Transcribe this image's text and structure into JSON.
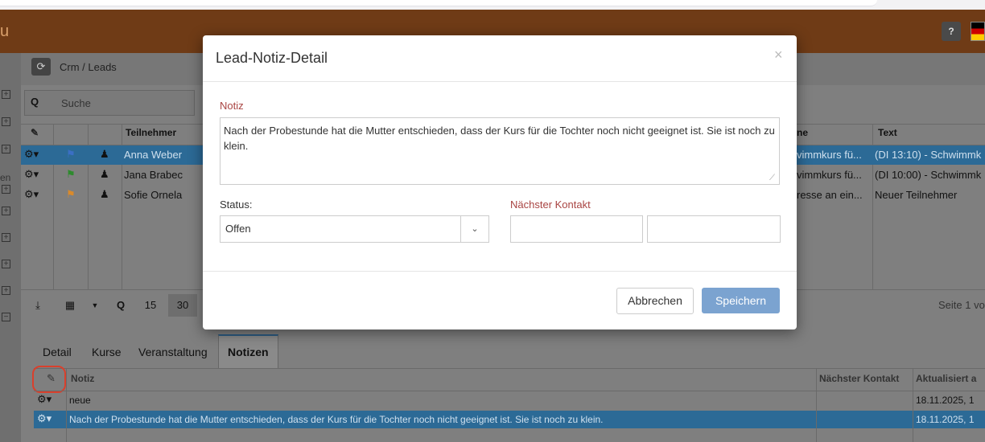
{
  "app": {
    "brand": "u"
  },
  "header": {
    "help_label": "?",
    "flag_label": "de"
  },
  "left_nav": {
    "labels": [
      "en"
    ]
  },
  "crm": {
    "breadcrumb": "Crm / Leads"
  },
  "search": {
    "placeholder": "Suche"
  },
  "grid": {
    "headers": {
      "teilnehmer": "Teilnehmer",
      "name": "ne",
      "text": "Text"
    },
    "rows": [
      {
        "teilnehmer": "Anna Weber",
        "name": "vimmkurs fü...",
        "text": "(DI 13:10) - Schwimmk",
        "selected": true,
        "flag_color": "#3b6fc4"
      },
      {
        "teilnehmer": "Jana Brabec",
        "name": "vimmkurs fü...",
        "text": "(DI 10:00) - Schwimmk",
        "selected": false,
        "flag_color": "#2e8b2e"
      },
      {
        "teilnehmer": "Sofie Ornela",
        "name": "resse an ein...",
        "text": "Neuer Teilnehmer",
        "selected": false,
        "flag_color": "#d98a2b"
      }
    ]
  },
  "pager": {
    "size_15": "15",
    "size_30": "30",
    "page_text": "Seite 1 vo"
  },
  "detail_tabs": [
    "Detail",
    "Kurse",
    "Veranstaltung",
    "Notizen"
  ],
  "notes_table": {
    "headers": {
      "notiz": "Notiz",
      "naechster_kontakt": "Nächster Kontakt",
      "aktualisiert": "Aktualisiert a"
    },
    "rows": [
      {
        "notiz": "neue",
        "naechster_kontakt": "",
        "aktualisiert": "18.11.2025, 1",
        "selected": false
      },
      {
        "notiz": "Nach der Probestunde hat die Mutter entschieden, dass der Kurs für die Tochter noch nicht geeignet ist. Sie ist noch zu klein.",
        "naechster_kontakt": "",
        "aktualisiert": "18.11.2025, 1",
        "selected": true
      }
    ]
  },
  "modal": {
    "title": "Lead-Notiz-Detail",
    "close": "×",
    "notiz_label": "Notiz",
    "notiz_value": "Nach der Probestunde hat die Mutter entschieden, dass der Kurs für die Tochter noch nicht geeignet ist. Sie ist noch zu klein.",
    "status_label": "Status:",
    "status_value": "Offen",
    "nk_label": "Nächster Kontakt",
    "nk_date": "",
    "nk_time": "",
    "cancel": "Abbrechen",
    "save": "Speichern"
  }
}
